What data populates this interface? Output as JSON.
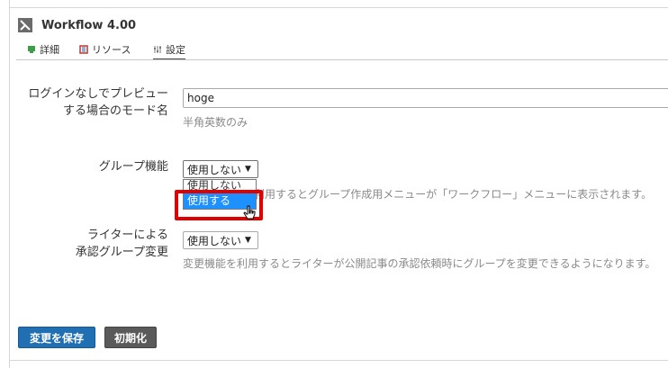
{
  "header": {
    "title": "Workflow 4.00"
  },
  "tabs": [
    {
      "label": "詳細",
      "icon": "details-icon"
    },
    {
      "label": "リソース",
      "icon": "resources-icon"
    },
    {
      "label": "設定",
      "icon": "settings-icon",
      "active": true
    }
  ],
  "form": {
    "mode_name": {
      "label_line1": "ログインなしでプレビュー",
      "label_line2": "する場合のモード名",
      "value": "hoge",
      "help": "半角英数のみ"
    },
    "group": {
      "label": "グループ機能",
      "selected": "使用しない",
      "options": [
        "使用しない",
        "使用する"
      ],
      "highlighted": "使用する",
      "help": "利用するとグループ作成用メニューが「ワークフロー」メニューに表示されます。"
    },
    "writer": {
      "label_line1": "ライターによる",
      "label_line2": "承認グループ変更",
      "selected": "使用しない",
      "help": "変更機能を利用するとライターが公開記事の承認依頼時にグループを変更できるようになります。"
    }
  },
  "buttons": {
    "save": "変更を保存",
    "reset": "初期化"
  },
  "colors": {
    "highlight_box": "#e00000",
    "selected_option": "#1e90ff",
    "save_button": "#1f6fb2",
    "reset_button": "#5a5a5a"
  }
}
